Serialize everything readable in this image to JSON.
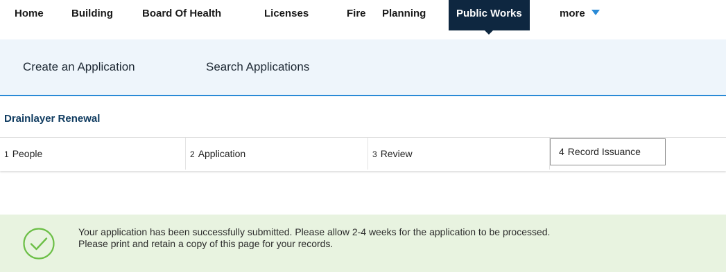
{
  "topnav": {
    "items": [
      "Home",
      "Building",
      "Board Of Health",
      "Licenses",
      "Fire",
      "Planning",
      "Public Works"
    ],
    "more_label": "more",
    "active": "Public Works"
  },
  "subnav": {
    "create": "Create an Application",
    "search": "Search Applications"
  },
  "page": {
    "title": "Drainlayer Renewal"
  },
  "steps": [
    {
      "num": "1",
      "label": "People"
    },
    {
      "num": "2",
      "label": "Application"
    },
    {
      "num": "3",
      "label": "Review"
    },
    {
      "num": "4",
      "label": "Record Issuance"
    }
  ],
  "banner": {
    "line1": "Your application has been successfully submitted. Please allow 2-4 weeks for the application to be processed.",
    "line2": "Please print and retain a copy of this page for your records.",
    "icon": "check-circle-icon",
    "color": "#6cbf47"
  }
}
